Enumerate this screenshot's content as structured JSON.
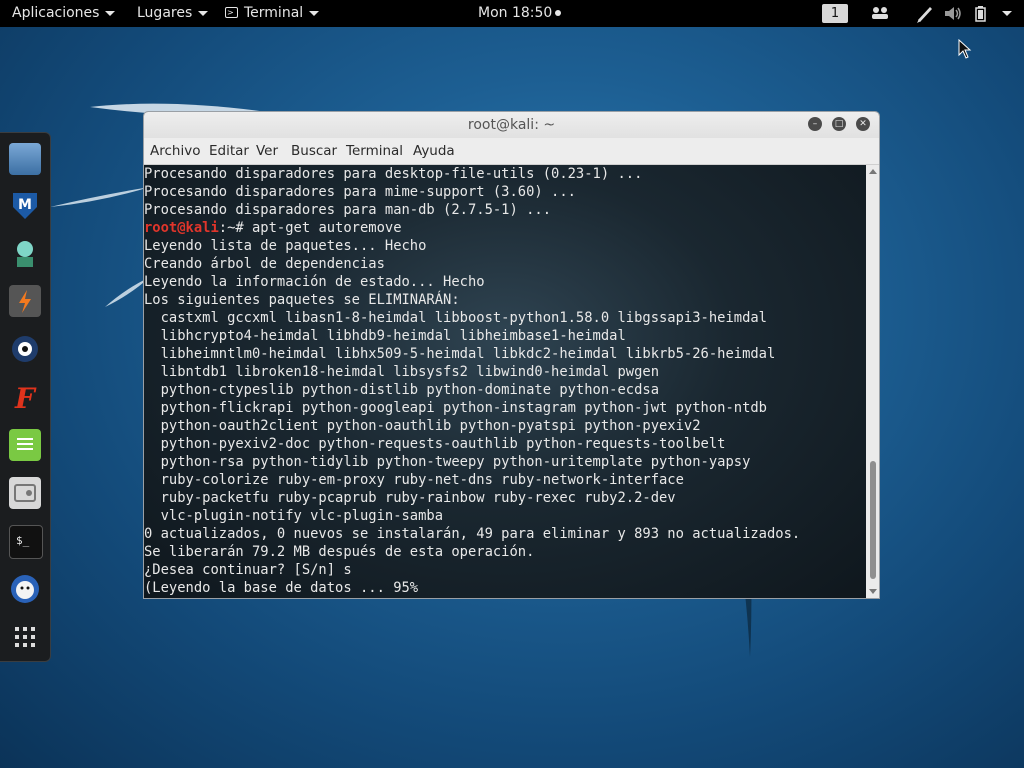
{
  "topbar": {
    "apps_label": "Aplicaciones",
    "places_label": "Lugares",
    "terminal_label": "Terminal",
    "clock": "Mon 18:50",
    "workspace": "1",
    "icons": [
      "workspace-indicator",
      "people-icon",
      "pen-icon",
      "volume-icon",
      "battery-icon",
      "system-menu-caret"
    ]
  },
  "dock": {
    "items": [
      "files-icon",
      "metasploit-icon",
      "armitage-icon",
      "burpsuite-icon",
      "maltego-icon",
      "faraday-icon",
      "notes-icon",
      "settings-icon",
      "terminal-icon",
      "cherrytree-icon",
      "show-apps-icon"
    ]
  },
  "window": {
    "title": "root@kali: ~",
    "menu": [
      "Archivo",
      "Editar",
      "Ver",
      "Buscar",
      "Terminal",
      "Ayuda"
    ],
    "prompt_user": "root@kali",
    "prompt_rest": ":~# apt-get autoremove",
    "lines_before": [
      "Procesando disparadores para desktop-file-utils (0.23-1) ...",
      "Procesando disparadores para mime-support (3.60) ...",
      "Procesando disparadores para man-db (2.7.5-1) ..."
    ],
    "lines_after": [
      "Leyendo lista de paquetes... Hecho",
      "Creando árbol de dependencias",
      "Leyendo la información de estado... Hecho",
      "Los siguientes paquetes se ELIMINARÁN:",
      "  castxml gccxml libasn1-8-heimdal libboost-python1.58.0 libgssapi3-heimdal",
      "  libhcrypto4-heimdal libhdb9-heimdal libheimbase1-heimdal",
      "  libheimntlm0-heimdal libhx509-5-heimdal libkdc2-heimdal libkrb5-26-heimdal",
      "  libntdb1 libroken18-heimdal libsysfs2 libwind0-heimdal pwgen",
      "  python-ctypeslib python-distlib python-dominate python-ecdsa",
      "  python-flickrapi python-googleapi python-instagram python-jwt python-ntdb",
      "  python-oauth2client python-oauthlib python-pyatspi python-pyexiv2",
      "  python-pyexiv2-doc python-requests-oauthlib python-requests-toolbelt",
      "  python-rsa python-tidylib python-tweepy python-uritemplate python-yapsy",
      "  ruby-colorize ruby-em-proxy ruby-net-dns ruby-network-interface",
      "  ruby-packetfu ruby-pcaprub ruby-rainbow ruby-rexec ruby2.2-dev",
      "  vlc-plugin-notify vlc-plugin-samba",
      "0 actualizados, 0 nuevos se instalarán, 49 para eliminar y 893 no actualizados.",
      "Se liberarán 79.2 MB después de esta operación.",
      "¿Desea continuar? [S/n] s",
      "(Leyendo la base de datos ... 95%"
    ]
  },
  "colors": {
    "prompt": "#e0352b",
    "terminal_text": "#e8e8e8",
    "desktop": "#1d5f93"
  }
}
